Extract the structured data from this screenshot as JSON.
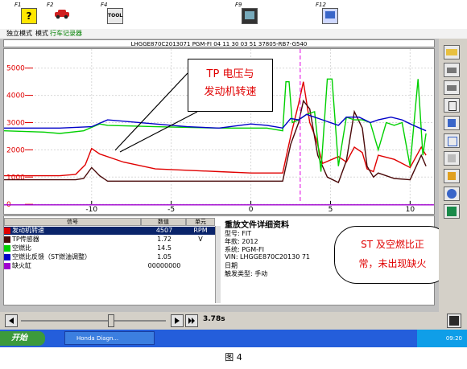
{
  "toolbar": {
    "keys": [
      {
        "label": "F1",
        "icon": "help-icon"
      },
      {
        "label": "F2",
        "icon": "car-icon"
      },
      {
        "label": "F4",
        "icon": "tool-icon",
        "icon_text": "TOOL"
      },
      {
        "label": "F9",
        "icon": "monitor-icon"
      },
      {
        "label": "F12",
        "icon": "printer-screen-icon"
      }
    ]
  },
  "modebar": {
    "item1": "独立模式",
    "item2": "模式",
    "item3": "行车记录器"
  },
  "vehicle_info": "LHGGE870C2013071  PGM-FI 04 11 30 03 51  37805-RB7-G540",
  "chart_data": {
    "type": "line",
    "x_ticks": [
      "-10",
      "-5",
      "0",
      "5",
      "10"
    ],
    "x_range": [
      -15.5,
      11.5
    ],
    "y_ticks": [
      "5000",
      "4000",
      "3000",
      "2000",
      "1000",
      "0"
    ],
    "y_range": [
      -350,
      5700
    ],
    "grid": true,
    "cursor_x": 3.1,
    "colors": {
      "red": "#e00000",
      "dark": "#4a0a0a",
      "green": "#00d000",
      "blue": "#0000c8",
      "purple": "#a000d0",
      "axis_tick": "#e00000"
    },
    "series": [
      {
        "color": "red",
        "x": [
          -15.5,
          -12,
          -11,
          -10.4,
          -10,
          -9.5,
          -8,
          -6,
          -4,
          -2,
          0,
          1,
          2,
          2.5,
          3,
          3.3,
          3.7,
          4.1,
          4.5,
          5.5,
          6,
          6.5,
          7,
          7.3,
          7.7,
          8,
          9,
          10,
          10.7,
          11
        ],
        "y": [
          1050,
          1050,
          1100,
          1450,
          2050,
          1850,
          1550,
          1300,
          1250,
          1200,
          1150,
          1150,
          1150,
          2500,
          3700,
          4500,
          3000,
          2400,
          1500,
          1750,
          1550,
          2100,
          1900,
          1300,
          1200,
          1800,
          1650,
          1350,
          2100,
          1800
        ]
      },
      {
        "color": "dark",
        "x": [
          -15.5,
          -11,
          -10.5,
          -10,
          -9.5,
          -9,
          -6,
          -2,
          0,
          1.5,
          2,
          2.5,
          3,
          3.3,
          3.7,
          4.2,
          4.8,
          5.5,
          6,
          6.5,
          7,
          7.3,
          7.7,
          8,
          9,
          10,
          10.7,
          11
        ],
        "y": [
          900,
          900,
          950,
          1350,
          1050,
          850,
          850,
          850,
          850,
          850,
          850,
          2200,
          3000,
          3800,
          3500,
          1800,
          1000,
          800,
          1600,
          3400,
          2800,
          1400,
          1000,
          1150,
          950,
          900,
          1800,
          1400
        ]
      },
      {
        "color": "green",
        "x": [
          -15.5,
          -13,
          -12,
          -10.5,
          -9.5,
          -9,
          -6,
          -2,
          1,
          2,
          2.2,
          2.4,
          2.6,
          3,
          3.5,
          4,
          4.4,
          4.8,
          5.1,
          5.5,
          6,
          6.5,
          7,
          7.5,
          8,
          8.5,
          9,
          9.5,
          10,
          10.5,
          10.8,
          11
        ],
        "y": [
          2700,
          2650,
          2600,
          2700,
          2950,
          2900,
          2850,
          2800,
          2800,
          2700,
          4500,
          4500,
          3000,
          3100,
          3300,
          3400,
          1200,
          4600,
          4600,
          1400,
          3200,
          3100,
          3100,
          3000,
          2000,
          3000,
          2900,
          3000,
          1400,
          4600,
          1800,
          2600
        ]
      },
      {
        "color": "blue",
        "x": [
          -15.5,
          -12,
          -10,
          -9,
          -6,
          -4,
          -2,
          0,
          1,
          1.5,
          2,
          2.5,
          3,
          3.5,
          4,
          4.5,
          5.5,
          6,
          6.8,
          7.5,
          8,
          8.8,
          9.5,
          10.2,
          11
        ],
        "y": [
          2800,
          2800,
          2850,
          3100,
          2950,
          2850,
          2800,
          2950,
          2900,
          2850,
          2800,
          3150,
          3100,
          3300,
          3200,
          3100,
          2900,
          3200,
          3200,
          3000,
          3100,
          3200,
          3100,
          2900,
          2700
        ]
      },
      {
        "color": "purple",
        "x": [
          -15.5,
          11.5
        ],
        "y": [
          -20,
          -20
        ]
      }
    ],
    "annotation": {
      "line1": "TP 电压与",
      "line2": "发动机转速"
    }
  },
  "table": {
    "headers": {
      "signal": "信号",
      "value": "数值",
      "unit": "单元"
    },
    "rows": [
      {
        "name": "发动机转速",
        "value": "4507",
        "unit": "RPM",
        "color": "#e00000",
        "selected": true
      },
      {
        "name": "TP传感器",
        "value": "1.72",
        "unit": "V",
        "color": "#4a0a0a",
        "selected": false
      },
      {
        "name": "空燃比",
        "value": "14.5",
        "unit": "",
        "color": "#00d000",
        "selected": false
      },
      {
        "name": "空燃比反馈（ST燃油调整）",
        "value": "1.05",
        "unit": "",
        "color": "#0000c8",
        "selected": false
      },
      {
        "name": "缺火缸",
        "value": "00000000",
        "unit": "",
        "color": "#a000d0",
        "selected": false
      }
    ]
  },
  "details": {
    "title": "重放文件详细资料",
    "lines": [
      "型号: FIT",
      "年款: 2012",
      "系统: PGM-FI",
      "VIN: LHGGE870C20130 71",
      "日期",
      "触发类型: 手动"
    ]
  },
  "callout2": {
    "line1": "ST 及空燃比正",
    "line2": "常，未出现缺火"
  },
  "playback": {
    "time": "3.78s",
    "position": 0.62
  },
  "taskbar": {
    "start": "开始",
    "task": "Honda Diagn...",
    "clock": "09:20"
  },
  "caption": "图 4"
}
